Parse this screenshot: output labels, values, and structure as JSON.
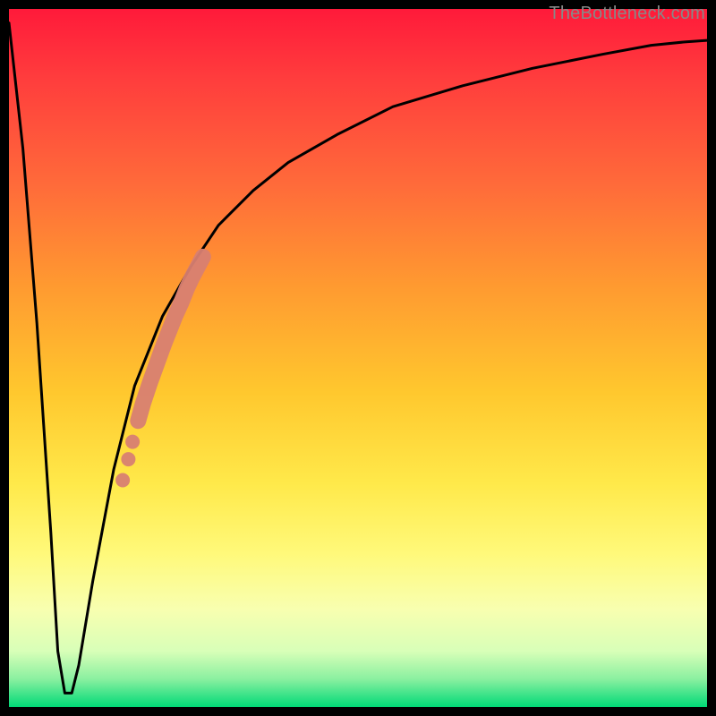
{
  "watermark": "TheBottleneck.com",
  "chart_data": {
    "type": "line",
    "title": "",
    "xlabel": "",
    "ylabel": "",
    "xlim": [
      0,
      100
    ],
    "ylim": [
      0,
      100
    ],
    "grid": false,
    "legend": false,
    "series": [
      {
        "name": "bottleneck-curve",
        "x": [
          0,
          2,
          4,
          6,
          7,
          8,
          9,
          10,
          12,
          15,
          18,
          22,
          26,
          30,
          35,
          40,
          47,
          55,
          65,
          75,
          85,
          92,
          97,
          100
        ],
        "y": [
          98,
          80,
          55,
          25,
          8,
          2,
          2,
          6,
          18,
          34,
          46,
          56,
          63,
          69,
          74,
          78,
          82,
          86,
          89,
          91.5,
          93.5,
          94.8,
          95.3,
          95.5
        ]
      }
    ],
    "markers": {
      "name": "highlighted-segment",
      "color": "#d88072",
      "points": [
        {
          "x": 18.5,
          "y": 41
        },
        {
          "x": 19.2,
          "y": 43.5
        },
        {
          "x": 20.2,
          "y": 46.5
        },
        {
          "x": 21.3,
          "y": 49.5
        },
        {
          "x": 22.2,
          "y": 52
        },
        {
          "x": 23.0,
          "y": 54
        },
        {
          "x": 23.8,
          "y": 56
        },
        {
          "x": 24.7,
          "y": 58
        },
        {
          "x": 25.5,
          "y": 60
        },
        {
          "x": 26.2,
          "y": 61.5
        },
        {
          "x": 27.0,
          "y": 63
        },
        {
          "x": 27.8,
          "y": 64.5
        }
      ]
    }
  }
}
